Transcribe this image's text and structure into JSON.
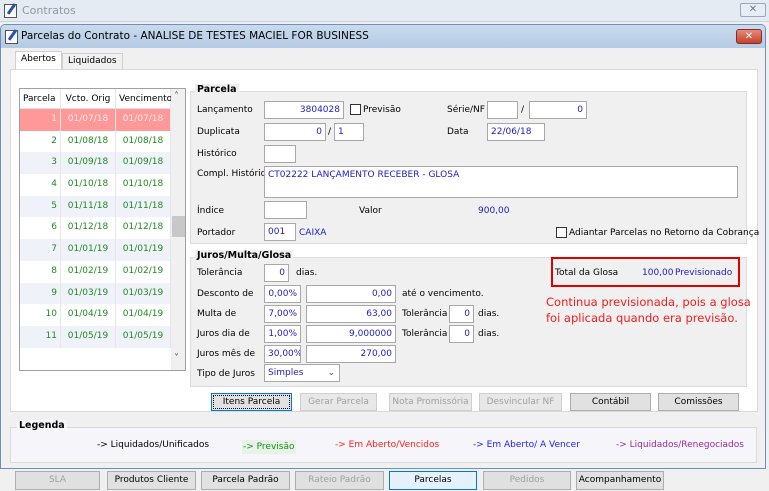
{
  "outer_window": {
    "title": "Contratos",
    "close": "✕"
  },
  "window": {
    "title": "Parcelas do Contrato - ANALISE DE TESTES MACIEL FOR BUSINESS",
    "close": "✕"
  },
  "tabs": [
    {
      "label": "Abertos",
      "active": true
    },
    {
      "label": "Liquidados",
      "active": false
    }
  ],
  "grid": {
    "columns": [
      "Parcela",
      "Vcto. Orig",
      "Vencimento"
    ],
    "rows": [
      [
        "1",
        "01/07/18",
        "01/07/18"
      ],
      [
        "2",
        "01/08/18",
        "01/08/18"
      ],
      [
        "3",
        "01/09/18",
        "01/09/18"
      ],
      [
        "4",
        "01/10/18",
        "01/10/18"
      ],
      [
        "5",
        "01/11/18",
        "01/11/18"
      ],
      [
        "6",
        "01/12/18",
        "01/12/18"
      ],
      [
        "7",
        "01/01/19",
        "01/01/19"
      ],
      [
        "8",
        "01/02/19",
        "01/02/19"
      ],
      [
        "9",
        "01/03/19",
        "01/03/19"
      ],
      [
        "10",
        "01/04/19",
        "01/04/19"
      ],
      [
        "11",
        "01/05/19",
        "01/05/19"
      ]
    ],
    "selected_row": 0,
    "scroll_up": "˄",
    "scroll_down": "˅"
  },
  "parcela": {
    "title": "Parcela",
    "lancamento_label": "Lançamento",
    "lancamento": "3804028",
    "previsao_label": "Previsão",
    "previsao_checked": false,
    "serie_nf_label": "Série/NF",
    "serie": "",
    "nf": "0",
    "slash": "/",
    "duplicata_label": "Duplicata",
    "duplicata": "0",
    "duplicata_parcela": "1",
    "data_label": "Data",
    "data": "22/06/18",
    "historico_label": "Histórico",
    "historico": "",
    "compl_historico_label": "Compl. Histórico",
    "compl_historico": "CT02222 LANÇAMENTO RECEBER - GLOSA",
    "indice_label": "Índice",
    "indice": "",
    "valor_label": "Valor",
    "valor": "900,00",
    "portador_label": "Portador",
    "portador_code": "001",
    "portador_name": "CAIXA",
    "adiantar_label": "Adiantar Parcelas no Retorno da Cobrança",
    "adiantar_checked": false
  },
  "juros": {
    "title": "Juros/Multa/Glosa",
    "tolerancia_label": "Tolerância",
    "tolerancia": "0",
    "dias": "dias.",
    "desconto_label": "Desconto de",
    "desconto_pct": "0,00%",
    "desconto_valor": "0,00",
    "ate_vencimento": "até o vencimento.",
    "multa_label": "Multa de",
    "multa_pct": "7,00%",
    "multa_valor": "63,00",
    "multa_tol_label": "Tolerância",
    "multa_tol": "0",
    "juros_dia_label": "Juros dia de",
    "juros_dia_pct": "1,00%",
    "juros_dia_valor": "9,000000",
    "juros_dia_tol_label": "Tolerância",
    "juros_dia_tol": "0",
    "juros_mes_label": "Juros mês de",
    "juros_mes_pct": "30,00%",
    "juros_mes_valor": "270,00",
    "tipo_label": "Tipo de Juros",
    "tipo": "Simples",
    "total_glosa_label": "Total da Glosa",
    "total_glosa": "100,00",
    "glosa_status": "Previsionado"
  },
  "annotation": {
    "line1": "Continua previsionada, pois a glosa",
    "line2": "foi aplicada quando era previsão."
  },
  "buttons": {
    "itens": "Itens Parcela",
    "gerar": "Gerar Parcela",
    "nota": "Nota Promissória",
    "desvincular": "Desvincular NF",
    "contabil": "Contábil",
    "comissoes": "Comissões"
  },
  "legend": {
    "title": "Legenda",
    "items": [
      {
        "label": "-> Liquidados/Unificados",
        "color": "#000000"
      },
      {
        "label": "-> Previsão",
        "color": "#1f8a1f"
      },
      {
        "label": "-> Em Aberto/Vencidos",
        "color": "#ff2020"
      },
      {
        "label": "-> Em Aberto/ A Vencer",
        "color": "#2020ff"
      },
      {
        "label": "-> Liquidados/Renegociados",
        "color": "#9a2aa0"
      }
    ]
  },
  "bottom_tabs": [
    {
      "label": "SLA",
      "enabled": false
    },
    {
      "label": "Produtos Cliente",
      "enabled": true
    },
    {
      "label": "Parcela Padrão",
      "enabled": true
    },
    {
      "label": "Rateio Padrão",
      "enabled": false
    },
    {
      "label": "Parcelas",
      "enabled": true,
      "active": true
    },
    {
      "label": "Pedidos",
      "enabled": false
    },
    {
      "label": "Acompanhamento",
      "enabled": true
    }
  ]
}
